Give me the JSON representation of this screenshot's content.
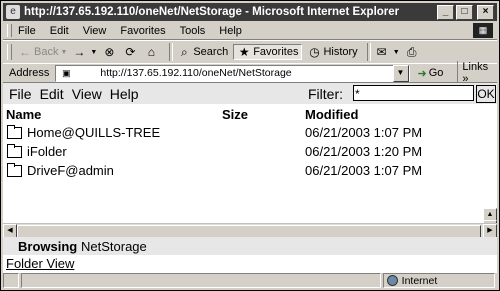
{
  "window": {
    "title": "http://137.65.192.110/oneNet/NetStorage - Microsoft Internet Explorer",
    "minimize_glyph": "_",
    "maximize_glyph": "□",
    "close_glyph": "×"
  },
  "ie_menu": [
    "File",
    "Edit",
    "View",
    "Favorites",
    "Tools",
    "Help"
  ],
  "toolbar": {
    "back_label": "Back",
    "search_label": "Search",
    "favorites_label": "Favorites",
    "history_label": "History"
  },
  "address": {
    "label": "Address",
    "url": "http://137.65.192.110/oneNet/NetStorage",
    "go_label": "Go",
    "links_label": "Links »"
  },
  "app": {
    "menu": [
      "File",
      "Edit",
      "View",
      "Help"
    ],
    "filter_label": "Filter:",
    "filter_value": "*",
    "ok_label": "OK",
    "columns": {
      "name": "Name",
      "size": "Size",
      "modified": "Modified"
    },
    "files": [
      {
        "name": "Home@QUILLS-TREE",
        "size": "",
        "modified": "06/21/2003 1:07 PM"
      },
      {
        "name": "iFolder",
        "size": "",
        "modified": "06/21/2003 1:20 PM"
      },
      {
        "name": "DriveF@admin",
        "size": "",
        "modified": "06/21/2003 1:07 PM"
      }
    ],
    "browsing_label": "Browsing",
    "browsing_location": "NetStorage",
    "folder_view_link": "Folder View"
  },
  "status": {
    "zone": "Internet"
  },
  "icons": [
    "ie-page-icon",
    "ie-logo-icon",
    "back-arrow-icon",
    "forward-arrow-icon",
    "stop-icon",
    "refresh-icon",
    "home-icon",
    "search-icon",
    "favorites-icon",
    "history-icon",
    "mail-icon",
    "print-icon",
    "go-arrow-icon",
    "folder-icon",
    "globe-icon"
  ]
}
